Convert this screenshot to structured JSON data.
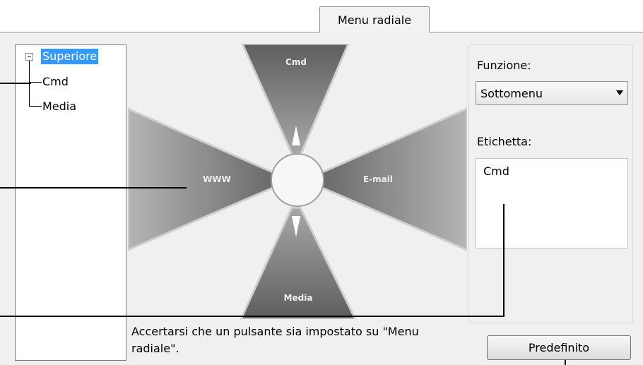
{
  "tab": {
    "label": "Menu radiale"
  },
  "tree": {
    "items": [
      {
        "label": "Superiore",
        "selected": true
      },
      {
        "label": "Cmd",
        "selected": false
      },
      {
        "label": "Media",
        "selected": false
      }
    ]
  },
  "radial": {
    "top": "Cmd",
    "left": "WWW",
    "right": "E-mail",
    "bottom": "Media"
  },
  "function": {
    "label": "Funzione:",
    "value": "Sottomenu"
  },
  "caption": {
    "label": "Etichetta:",
    "value": "Cmd"
  },
  "note": "Accertarsi che un pulsante sia impostato su \"Menu radiale\".",
  "buttons": {
    "default": "Predefinito"
  },
  "colors": {
    "selection": "#3399ff",
    "panel": "#f0f0f0"
  }
}
